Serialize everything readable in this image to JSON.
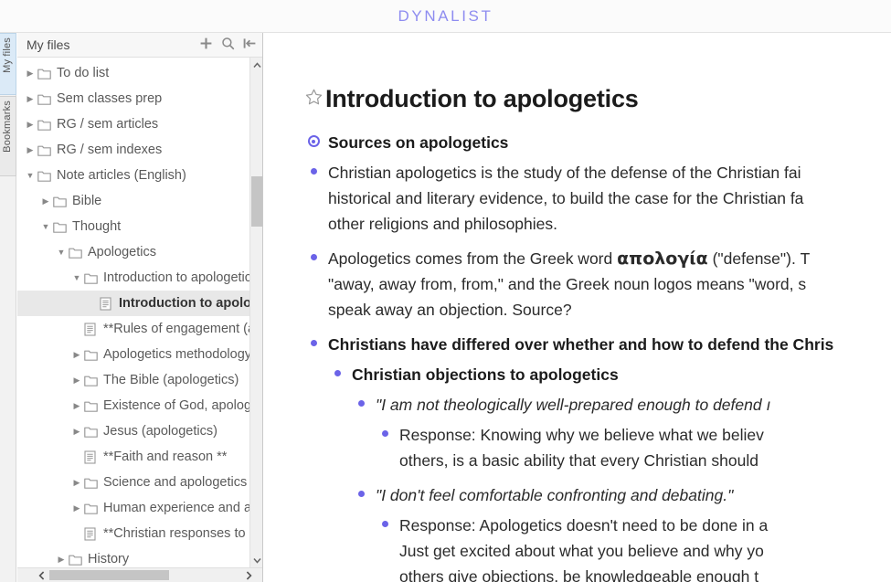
{
  "app": {
    "brand": "DYNALIST"
  },
  "rail": {
    "tabs": [
      {
        "id": "my-files",
        "label": "My files",
        "active": true
      },
      {
        "id": "bookmarks",
        "label": "Bookmarks",
        "active": false
      }
    ]
  },
  "sidebar": {
    "header": {
      "title": "My files",
      "actions": [
        {
          "id": "add",
          "icon": "plus-icon"
        },
        {
          "id": "search",
          "icon": "search-icon"
        },
        {
          "id": "collapse",
          "icon": "collapse-left-icon"
        }
      ]
    },
    "tree": [
      {
        "label": "To do list",
        "type": "folder",
        "depth": 0,
        "state": "collapsed",
        "selected": false
      },
      {
        "label": "Sem classes prep",
        "type": "folder",
        "depth": 0,
        "state": "collapsed",
        "selected": false
      },
      {
        "label": "RG / sem articles",
        "type": "folder",
        "depth": 0,
        "state": "collapsed",
        "selected": false
      },
      {
        "label": "RG / sem indexes",
        "type": "folder",
        "depth": 0,
        "state": "collapsed",
        "selected": false
      },
      {
        "label": "Note articles (English)",
        "type": "folder",
        "depth": 0,
        "state": "expanded",
        "selected": false
      },
      {
        "label": "Bible",
        "type": "folder",
        "depth": 1,
        "state": "collapsed",
        "selected": false
      },
      {
        "label": "Thought",
        "type": "folder",
        "depth": 1,
        "state": "expanded",
        "selected": false
      },
      {
        "label": "Apologetics",
        "type": "folder",
        "depth": 2,
        "state": "expanded",
        "selected": false
      },
      {
        "label": "Introduction to apologetics",
        "type": "folder",
        "depth": 3,
        "state": "expanded",
        "selected": false
      },
      {
        "label": "Introduction to apologetics",
        "type": "document",
        "depth": 4,
        "state": "none",
        "selected": true
      },
      {
        "label": "**Rules of engagement (apologetics) **",
        "type": "document",
        "depth": 3,
        "state": "none",
        "selected": false
      },
      {
        "label": "Apologetics methodology",
        "type": "folder",
        "depth": 3,
        "state": "collapsed",
        "selected": false
      },
      {
        "label": "The Bible (apologetics)",
        "type": "folder",
        "depth": 3,
        "state": "collapsed",
        "selected": false
      },
      {
        "label": "Existence of God, apologetics",
        "type": "folder",
        "depth": 3,
        "state": "collapsed",
        "selected": false
      },
      {
        "label": "Jesus (apologetics)",
        "type": "folder",
        "depth": 3,
        "state": "collapsed",
        "selected": false
      },
      {
        "label": "**Faith and reason **",
        "type": "document",
        "depth": 3,
        "state": "none",
        "selected": false
      },
      {
        "label": "Science and apologetics",
        "type": "folder",
        "depth": 3,
        "state": "collapsed",
        "selected": false
      },
      {
        "label": "Human experience and apologetics",
        "type": "folder",
        "depth": 3,
        "state": "collapsed",
        "selected": false
      },
      {
        "label": "**Christian responses to objections**",
        "type": "document",
        "depth": 3,
        "state": "none",
        "selected": false
      },
      {
        "label": "History",
        "type": "folder",
        "depth": 2,
        "state": "collapsed",
        "selected": false
      }
    ]
  },
  "document": {
    "title": "Introduction to apologetics",
    "starred": false,
    "items": {
      "sources_heading": "Sources on apologetics",
      "para1_line1": "Christian apologetics is the study of the defense of the Christian fai",
      "para1_line2": "historical and literary evidence, to build the case for the Christian fa",
      "para1_line3": "other religions and philosophies.",
      "para2_pre": "Apologetics comes from the Greek word ",
      "para2_greek": "απολογία",
      "para2_post": " (\"defense\"). T",
      "para2_line2": "\"away, away from, from,\" and the Greek noun logos means \"word, s",
      "para2_line3": "speak away an objection. Source?",
      "heading_differed": "Christians have differed over whether and how to defend the Chris",
      "heading_objections": "Christian objections to apologetics",
      "obj1": "\"I am not theologically well-prepared enough to defend ı",
      "obj1_resp_line1": "Response: Knowing why we believe what we believ",
      "obj1_resp_line2": "others, is a basic ability that every Christian should",
      "obj2": "\"I don't feel comfortable confronting and debating.\"",
      "obj2_resp_line1": "Response: Apologetics doesn't need to be done in a",
      "obj2_resp_line2": "Just get excited about what you believe and why yo",
      "obj2_resp_line3": "others give objections, be knowledgeable enough t"
    }
  },
  "colors": {
    "brand": "#8e8cf0",
    "bullet": "#6b63e8",
    "selection": "#e8e8e8",
    "tab_active": "#dbeaf7"
  }
}
